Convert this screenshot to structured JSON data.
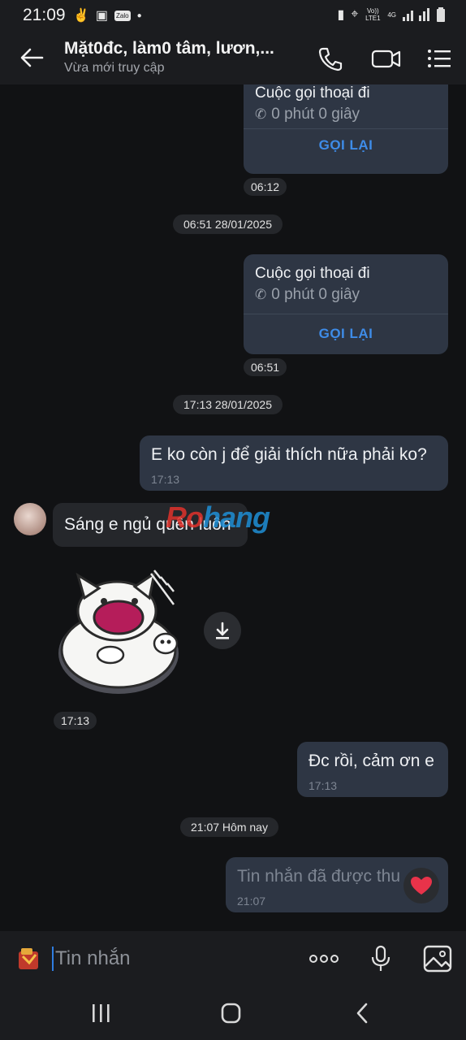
{
  "status_bar": {
    "time": "21:09",
    "zalo_label": "Zalo",
    "net1": "Vo)) LTE1",
    "net2": "4G"
  },
  "header": {
    "title": "Mặt0đc, làm0 tâm, lươn,...",
    "subtitle": "Vừa mới truy cập"
  },
  "messages": {
    "call1": {
      "title": "Cuộc gọi thoại đi",
      "duration": "0 phút 0 giây",
      "action": "GỌI LẠI",
      "time": "06:12"
    },
    "date1": "06:51 28/01/2025",
    "call2": {
      "title": "Cuộc gọi thoại đi",
      "duration": "0 phút 0 giây",
      "action": "GỌI LẠI",
      "time": "06:51"
    },
    "date2": "17:13 28/01/2025",
    "out1": {
      "text": "E ko còn j để giải thích nữa phải ko?",
      "time": "17:13"
    },
    "in1": {
      "text": "Sáng e ngủ quên luôn"
    },
    "sticker": {
      "time": "17:13"
    },
    "out2": {
      "text": "Đc rồi, cảm ơn e",
      "time": "17:13"
    },
    "date3": "21:07 Hôm nay",
    "recalled": {
      "text": "Tin nhắn đã được thu hồi",
      "time": "21:07"
    }
  },
  "watermark": {
    "part1": "Ro",
    "part2": "hang"
  },
  "input": {
    "placeholder": "Tin nhắn"
  },
  "colors": {
    "accent": "#3e8ce8",
    "bubble_out": "#2e3644",
    "bubble_in": "#25272b",
    "background": "#111214"
  }
}
